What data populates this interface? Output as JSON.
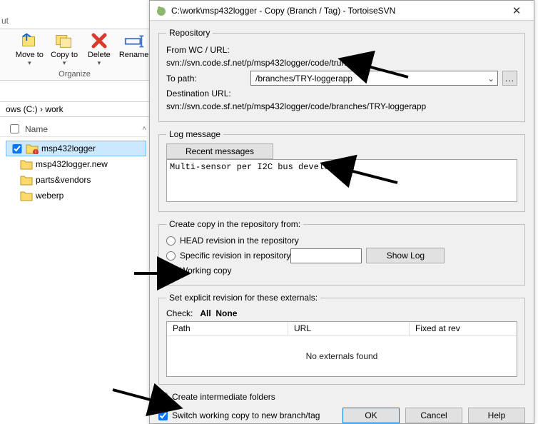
{
  "explorer": {
    "addr_prefix": "ows (C:)  ›  work",
    "name_col": "Name",
    "ribbon": {
      "move": "Move to",
      "copy": "Copy to",
      "delete": "Delete",
      "rename": "Rename",
      "group": "Organize",
      "cut_tab": "ut"
    },
    "items": [
      {
        "label": "msp432logger",
        "checked": true,
        "selected": true,
        "overlay": true
      },
      {
        "label": "msp432logger.new",
        "checked": false,
        "selected": false,
        "overlay": false
      },
      {
        "label": "parts&vendors",
        "checked": false,
        "selected": false,
        "overlay": false
      },
      {
        "label": "weberp",
        "checked": false,
        "selected": false,
        "overlay": false
      }
    ]
  },
  "dialog": {
    "title": "C:\\work\\msp432logger - Copy (Branch / Tag) - TortoiseSVN",
    "repository": {
      "legend": "Repository",
      "from_label": "From WC / URL:",
      "from_value": "svn://svn.code.sf.net/p/msp432logger/code/trunk",
      "to_label": "To path:",
      "to_value": "/branches/TRY-loggerapp",
      "browse": "...",
      "dest_label": "Destination URL:",
      "dest_value": "svn://svn.code.sf.net/p/msp432logger/code/branches/TRY-loggerapp"
    },
    "logmsg": {
      "legend": "Log message",
      "recent": "Recent messages",
      "text": "Multi-sensor per I2C bus development"
    },
    "create_from": {
      "legend": "Create copy in the repository from:",
      "head": "HEAD revision in the repository",
      "specific": "Specific revision in repository",
      "working": "Working copy",
      "showlog": "Show Log"
    },
    "externals": {
      "legend": "Set explicit revision for these externals:",
      "check_label": "Check:",
      "all": "All",
      "none": "None",
      "col_path": "Path",
      "col_url": "URL",
      "col_fixed": "Fixed at rev",
      "empty": "No externals found"
    },
    "bottom": {
      "intermediate": "Create intermediate folders",
      "switch_wc": "Switch working copy to new branch/tag",
      "ok": "OK",
      "cancel": "Cancel",
      "help": "Help"
    }
  }
}
